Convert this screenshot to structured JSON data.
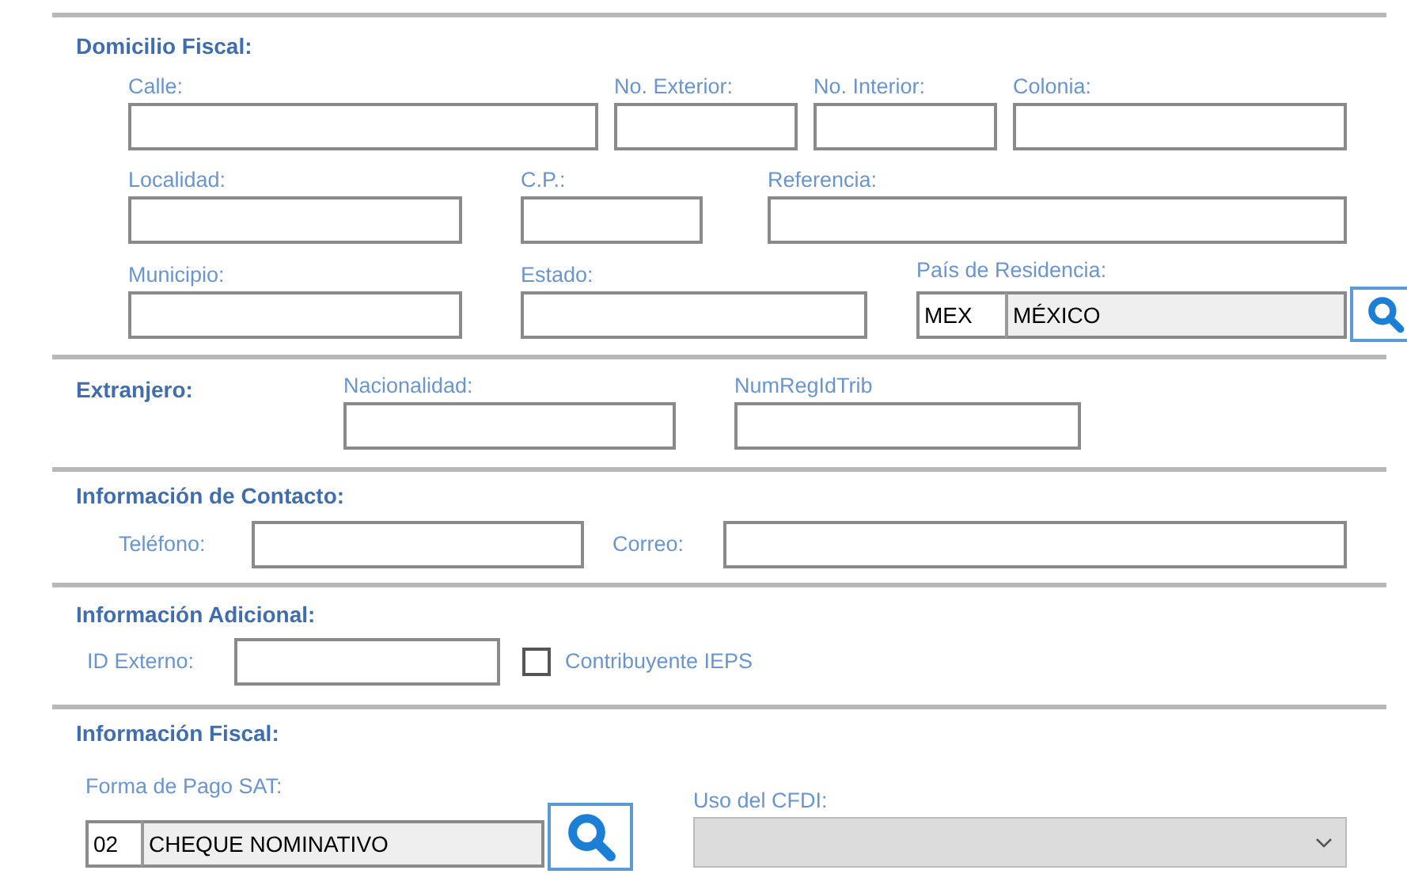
{
  "sections": [
    {
      "title": "Domicilio Fiscal:",
      "rows": [
        {
          "fields": [
            {
              "kind": "text",
              "label": "Calle:"
            },
            {
              "kind": "text",
              "label": "No. Exterior:"
            },
            {
              "kind": "text",
              "label": "No. Interior:"
            },
            {
              "kind": "text",
              "label": "Colonia:"
            }
          ]
        },
        {
          "fields": [
            {
              "kind": "text",
              "label": "Localidad:"
            },
            {
              "kind": "text",
              "label": "C.P.:"
            },
            {
              "kind": "text",
              "label": "Referencia:"
            }
          ]
        },
        {
          "fields": [
            {
              "kind": "text",
              "label": "Municipio:"
            },
            {
              "kind": "text",
              "label": "Estado:"
            },
            {
              "kind": "lookup",
              "label": "País de Residencia:",
              "code": "MEX",
              "name": "MÉXICO"
            }
          ]
        }
      ]
    },
    {
      "title": "Extranjero:",
      "rows": [
        {
          "fields": [
            {
              "kind": "text",
              "label": "Nacionalidad:"
            },
            {
              "kind": "text",
              "label": "NumRegIdTrib"
            }
          ]
        }
      ]
    },
    {
      "title": "Información de Contacto:",
      "rows": [
        {
          "fields": [
            {
              "kind": "inline",
              "label": "Teléfono:"
            },
            {
              "kind": "inline",
              "label": "Correo:"
            }
          ]
        }
      ]
    },
    {
      "title": "Información Adicional:",
      "rows": [
        {
          "fields": [
            {
              "kind": "inline",
              "label": "ID Externo:"
            },
            {
              "kind": "checkbox",
              "label": "Contribuyente IEPS",
              "checked": false
            }
          ]
        }
      ]
    },
    {
      "title": "Información Fiscal:",
      "rows": [
        {
          "fields": [
            {
              "kind": "lookup",
              "label": "Forma de Pago SAT:",
              "code": "02",
              "name": "CHEQUE NOMINATIVO"
            },
            {
              "kind": "dropdown",
              "label": "Uso del CFDI:",
              "disabled": true
            }
          ]
        }
      ]
    }
  ]
}
